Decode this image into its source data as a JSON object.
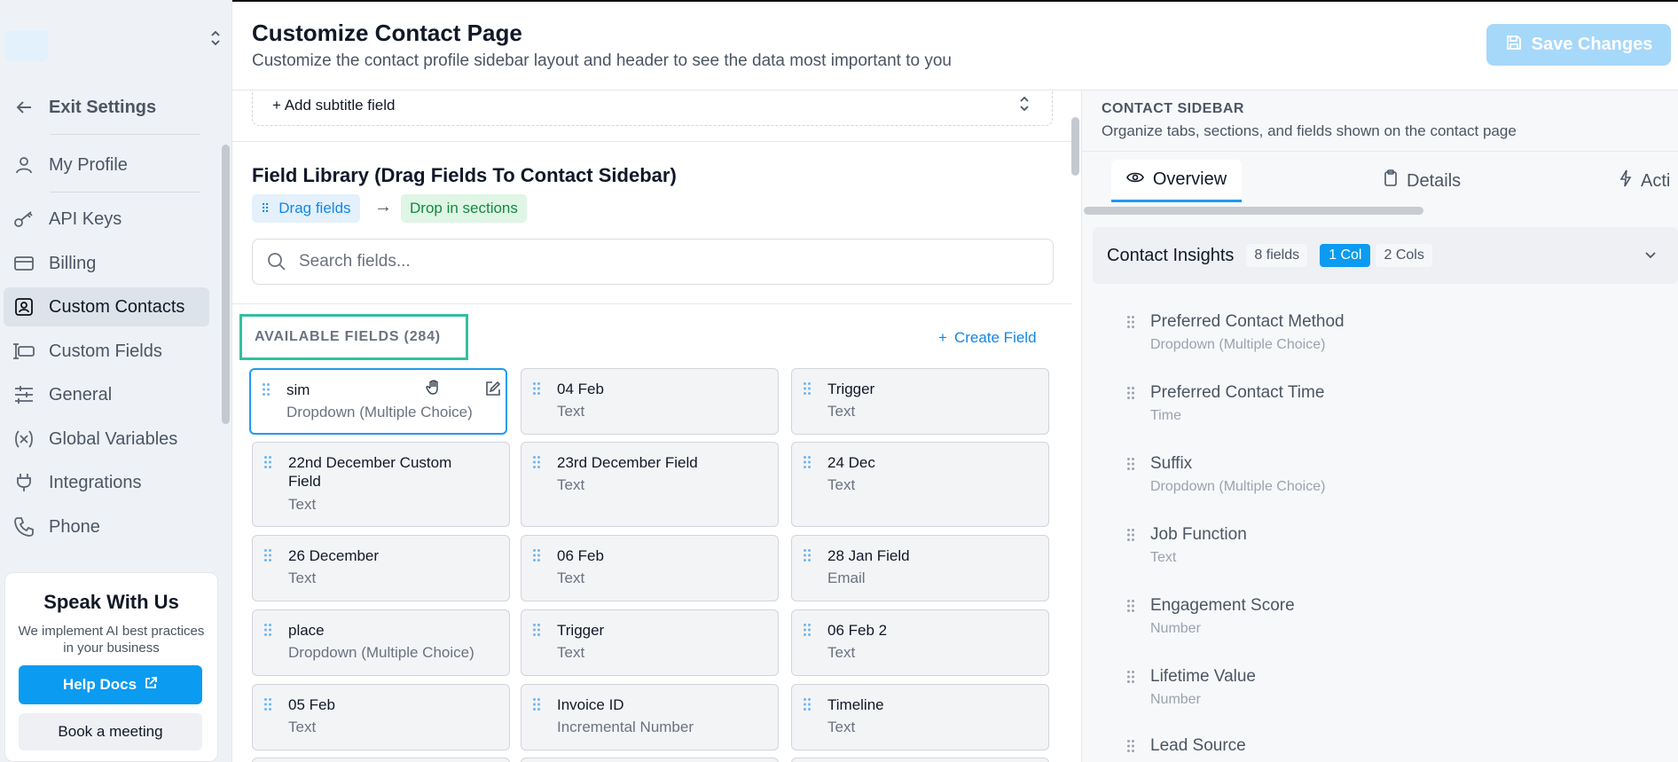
{
  "sidebar": {
    "items": [
      {
        "label": "Exit Settings",
        "icon": "arrow-left-icon"
      },
      {
        "label": "My Profile",
        "icon": "user-icon"
      },
      {
        "label": "API Keys",
        "icon": "key-icon"
      },
      {
        "label": "Billing",
        "icon": "credit-card-icon"
      },
      {
        "label": "Custom Contacts",
        "icon": "contact-card-icon",
        "active": true
      },
      {
        "label": "Custom Fields",
        "icon": "text-cursor-icon"
      },
      {
        "label": "General",
        "icon": "sliders-icon"
      },
      {
        "label": "Global Variables",
        "icon": "variable-icon"
      },
      {
        "label": "Integrations",
        "icon": "plug-icon"
      },
      {
        "label": "Phone",
        "icon": "phone-icon"
      }
    ],
    "promo": {
      "title": "Speak With Us",
      "text": "We implement AI best practices in your business",
      "help_label": "Help Docs",
      "book_label": "Book a meeting"
    }
  },
  "header": {
    "title": "Customize Contact Page",
    "subtitle": "Customize the contact profile sidebar layout and header to see the data most important to you",
    "save_label": "Save Changes"
  },
  "library": {
    "add_subtitle": "+ Add subtitle field",
    "title": "Field Library (Drag Fields To Contact Sidebar)",
    "chip_drag": "Drag fields",
    "arrow": "→",
    "chip_drop": "Drop in sections",
    "search_placeholder": "Search fields...",
    "available_label": "AVAILABLE FIELDS (284)",
    "create_label": "Create Field",
    "fields": [
      {
        "name": "sim",
        "type": "Dropdown (Multiple Choice)"
      },
      {
        "name": "04 Feb",
        "type": "Text"
      },
      {
        "name": "Trigger",
        "type": "Text"
      },
      {
        "name": "22nd December Custom Field",
        "type": "Text"
      },
      {
        "name": "23rd December Field",
        "type": "Text"
      },
      {
        "name": "24 Dec",
        "type": "Text"
      },
      {
        "name": "26 December",
        "type": "Text"
      },
      {
        "name": "06 Feb",
        "type": "Text"
      },
      {
        "name": "28 Jan Field",
        "type": "Email"
      },
      {
        "name": "place",
        "type": "Dropdown (Multiple Choice)"
      },
      {
        "name": "Trigger",
        "type": "Text"
      },
      {
        "name": "06 Feb 2",
        "type": "Text"
      },
      {
        "name": "05 Feb",
        "type": "Text"
      },
      {
        "name": "Invoice ID",
        "type": "Incremental Number"
      },
      {
        "name": "Timeline",
        "type": "Text"
      }
    ]
  },
  "contact_sidebar": {
    "title": "CONTACT SIDEBAR",
    "subtitle": "Organize tabs, sections, and fields shown on the contact page",
    "tabs": [
      {
        "label": "Overview",
        "icon": "eye-icon"
      },
      {
        "label": "Details",
        "icon": "clipboard-icon"
      },
      {
        "label": "Acti",
        "icon": "lightning-icon"
      }
    ],
    "section": {
      "name": "Contact Insights",
      "count": "8 fields",
      "col1": "1 Col",
      "col2": "2 Cols"
    },
    "fields": [
      {
        "name": "Preferred Contact Method",
        "type": "Dropdown (Multiple Choice)"
      },
      {
        "name": "Preferred Contact Time",
        "type": "Time"
      },
      {
        "name": "Suffix",
        "type": "Dropdown (Multiple Choice)"
      },
      {
        "name": "Job Function",
        "type": "Text"
      },
      {
        "name": "Engagement Score",
        "type": "Number"
      },
      {
        "name": "Lifetime Value",
        "type": "Number"
      },
      {
        "name": "Lead Source",
        "type": ""
      }
    ]
  },
  "colors": {
    "accent": "#0b9bf0",
    "highlight": "#34bfa0",
    "success": "#14883e"
  }
}
